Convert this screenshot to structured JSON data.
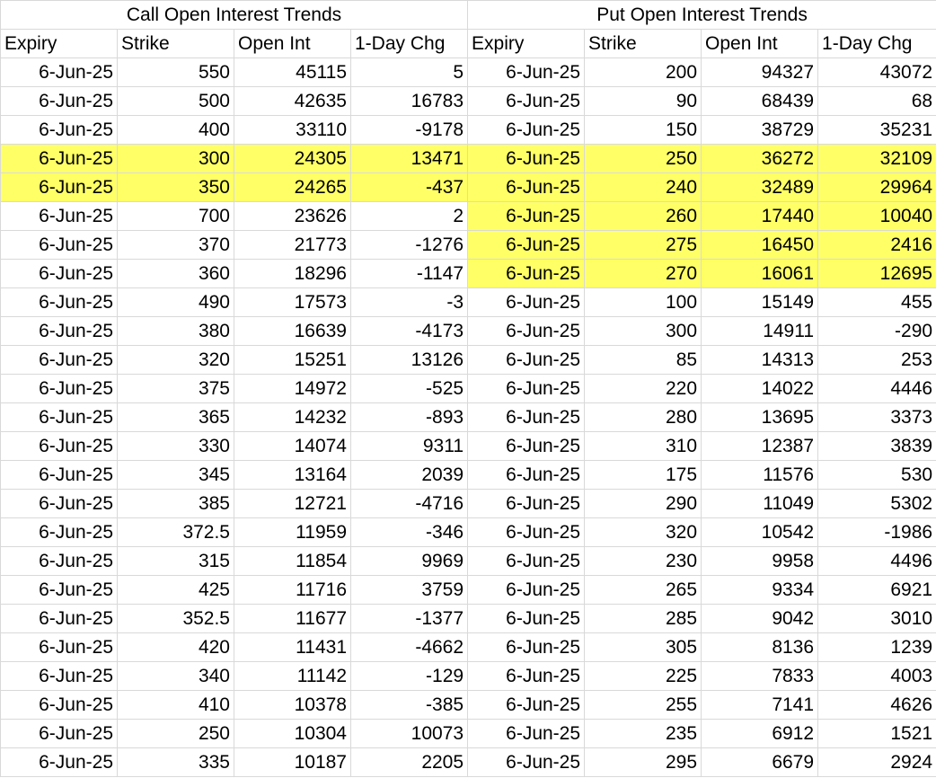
{
  "titles": {
    "call": "Call Open Interest Trends",
    "put": "Put Open Interest Trends"
  },
  "headers": [
    "Expiry",
    "Strike",
    "Open Int",
    "1-Day Chg",
    "Expiry",
    "Strike",
    "Open Int",
    "1-Day Chg"
  ],
  "highlight_color": "#ffff66",
  "rows": [
    {
      "c": [
        "6-Jun-25",
        "550",
        "45115",
        "5"
      ],
      "p": [
        "6-Jun-25",
        "200",
        "94327",
        "43072"
      ],
      "hc": false,
      "hp": false
    },
    {
      "c": [
        "6-Jun-25",
        "500",
        "42635",
        "16783"
      ],
      "p": [
        "6-Jun-25",
        "90",
        "68439",
        "68"
      ],
      "hc": false,
      "hp": false
    },
    {
      "c": [
        "6-Jun-25",
        "400",
        "33110",
        "-9178"
      ],
      "p": [
        "6-Jun-25",
        "150",
        "38729",
        "35231"
      ],
      "hc": false,
      "hp": false
    },
    {
      "c": [
        "6-Jun-25",
        "300",
        "24305",
        "13471"
      ],
      "p": [
        "6-Jun-25",
        "250",
        "36272",
        "32109"
      ],
      "hc": true,
      "hp": true
    },
    {
      "c": [
        "6-Jun-25",
        "350",
        "24265",
        "-437"
      ],
      "p": [
        "6-Jun-25",
        "240",
        "32489",
        "29964"
      ],
      "hc": true,
      "hp": true
    },
    {
      "c": [
        "6-Jun-25",
        "700",
        "23626",
        "2"
      ],
      "p": [
        "6-Jun-25",
        "260",
        "17440",
        "10040"
      ],
      "hc": false,
      "hp": true
    },
    {
      "c": [
        "6-Jun-25",
        "370",
        "21773",
        "-1276"
      ],
      "p": [
        "6-Jun-25",
        "275",
        "16450",
        "2416"
      ],
      "hc": false,
      "hp": true
    },
    {
      "c": [
        "6-Jun-25",
        "360",
        "18296",
        "-1147"
      ],
      "p": [
        "6-Jun-25",
        "270",
        "16061",
        "12695"
      ],
      "hc": false,
      "hp": true
    },
    {
      "c": [
        "6-Jun-25",
        "490",
        "17573",
        "-3"
      ],
      "p": [
        "6-Jun-25",
        "100",
        "15149",
        "455"
      ],
      "hc": false,
      "hp": false
    },
    {
      "c": [
        "6-Jun-25",
        "380",
        "16639",
        "-4173"
      ],
      "p": [
        "6-Jun-25",
        "300",
        "14911",
        "-290"
      ],
      "hc": false,
      "hp": false
    },
    {
      "c": [
        "6-Jun-25",
        "320",
        "15251",
        "13126"
      ],
      "p": [
        "6-Jun-25",
        "85",
        "14313",
        "253"
      ],
      "hc": false,
      "hp": false
    },
    {
      "c": [
        "6-Jun-25",
        "375",
        "14972",
        "-525"
      ],
      "p": [
        "6-Jun-25",
        "220",
        "14022",
        "4446"
      ],
      "hc": false,
      "hp": false
    },
    {
      "c": [
        "6-Jun-25",
        "365",
        "14232",
        "-893"
      ],
      "p": [
        "6-Jun-25",
        "280",
        "13695",
        "3373"
      ],
      "hc": false,
      "hp": false
    },
    {
      "c": [
        "6-Jun-25",
        "330",
        "14074",
        "9311"
      ],
      "p": [
        "6-Jun-25",
        "310",
        "12387",
        "3839"
      ],
      "hc": false,
      "hp": false
    },
    {
      "c": [
        "6-Jun-25",
        "345",
        "13164",
        "2039"
      ],
      "p": [
        "6-Jun-25",
        "175",
        "11576",
        "530"
      ],
      "hc": false,
      "hp": false
    },
    {
      "c": [
        "6-Jun-25",
        "385",
        "12721",
        "-4716"
      ],
      "p": [
        "6-Jun-25",
        "290",
        "11049",
        "5302"
      ],
      "hc": false,
      "hp": false
    },
    {
      "c": [
        "6-Jun-25",
        "372.5",
        "11959",
        "-346"
      ],
      "p": [
        "6-Jun-25",
        "320",
        "10542",
        "-1986"
      ],
      "hc": false,
      "hp": false
    },
    {
      "c": [
        "6-Jun-25",
        "315",
        "11854",
        "9969"
      ],
      "p": [
        "6-Jun-25",
        "230",
        "9958",
        "4496"
      ],
      "hc": false,
      "hp": false
    },
    {
      "c": [
        "6-Jun-25",
        "425",
        "11716",
        "3759"
      ],
      "p": [
        "6-Jun-25",
        "265",
        "9334",
        "6921"
      ],
      "hc": false,
      "hp": false
    },
    {
      "c": [
        "6-Jun-25",
        "352.5",
        "11677",
        "-1377"
      ],
      "p": [
        "6-Jun-25",
        "285",
        "9042",
        "3010"
      ],
      "hc": false,
      "hp": false
    },
    {
      "c": [
        "6-Jun-25",
        "420",
        "11431",
        "-4662"
      ],
      "p": [
        "6-Jun-25",
        "305",
        "8136",
        "1239"
      ],
      "hc": false,
      "hp": false
    },
    {
      "c": [
        "6-Jun-25",
        "340",
        "11142",
        "-129"
      ],
      "p": [
        "6-Jun-25",
        "225",
        "7833",
        "4003"
      ],
      "hc": false,
      "hp": false
    },
    {
      "c": [
        "6-Jun-25",
        "410",
        "10378",
        "-385"
      ],
      "p": [
        "6-Jun-25",
        "255",
        "7141",
        "4626"
      ],
      "hc": false,
      "hp": false
    },
    {
      "c": [
        "6-Jun-25",
        "250",
        "10304",
        "10073"
      ],
      "p": [
        "6-Jun-25",
        "235",
        "6912",
        "1521"
      ],
      "hc": false,
      "hp": false
    },
    {
      "c": [
        "6-Jun-25",
        "335",
        "10187",
        "2205"
      ],
      "p": [
        "6-Jun-25",
        "295",
        "6679",
        "2924"
      ],
      "hc": false,
      "hp": false
    }
  ]
}
